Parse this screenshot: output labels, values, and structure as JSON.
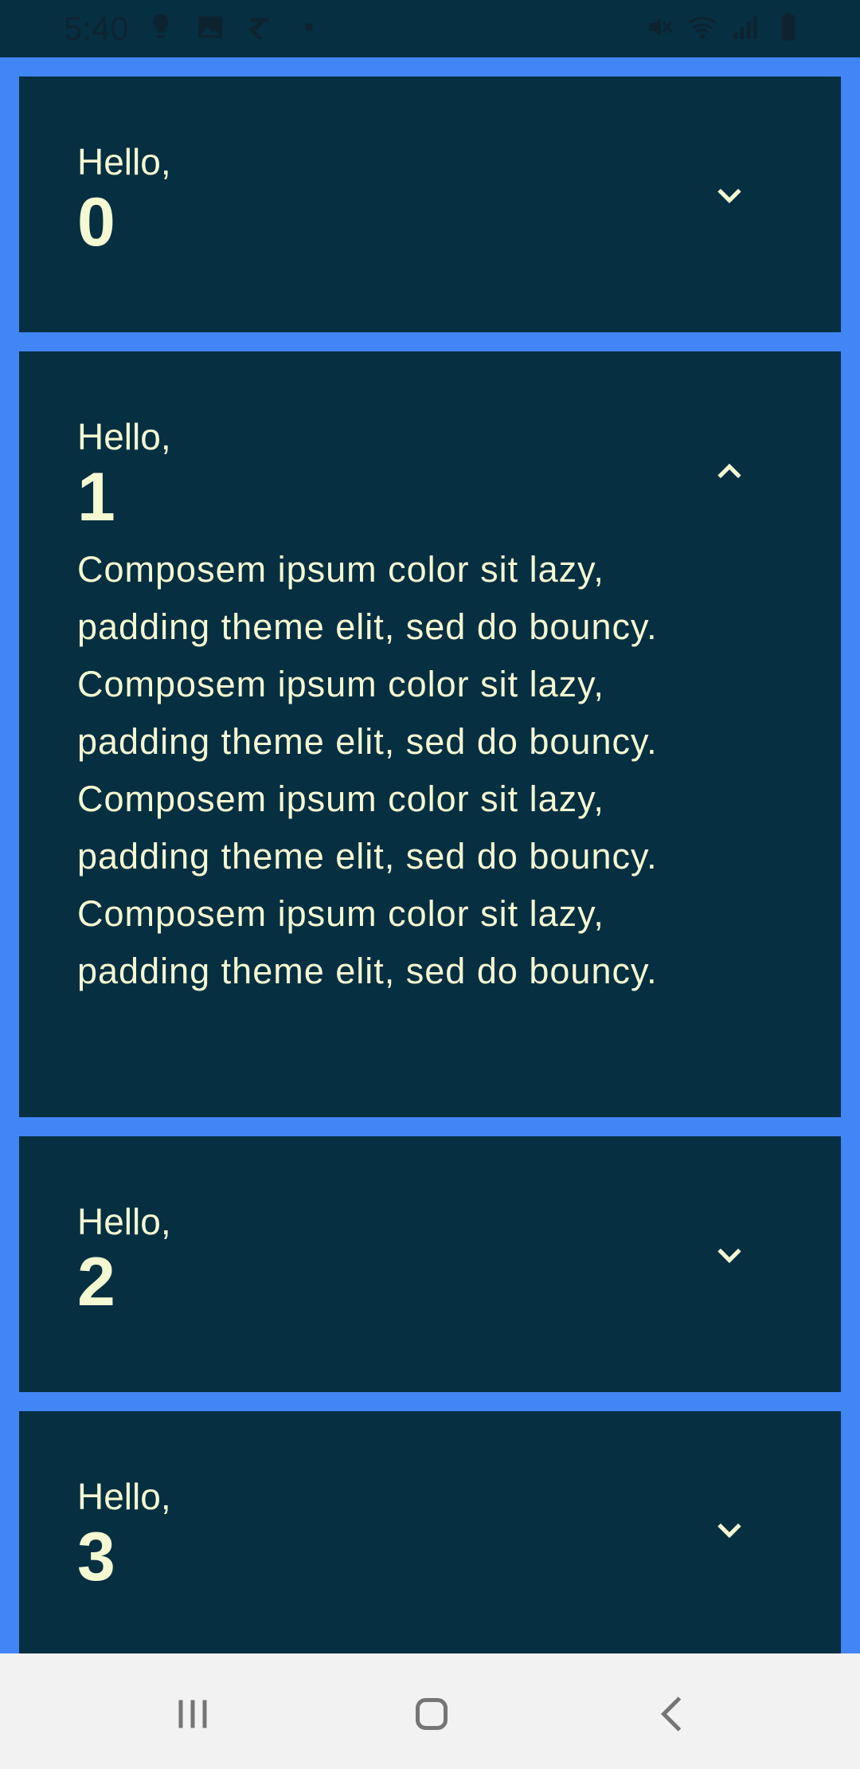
{
  "status_bar": {
    "time": "5:40",
    "left_icons": [
      "bulb-icon",
      "image-icon",
      "rupee-app-icon",
      "dot-icon"
    ],
    "right_icons": [
      "mute-icon",
      "wifi-icon",
      "signal-icon",
      "battery-icon"
    ]
  },
  "cards": [
    {
      "greeting": "Hello,",
      "number": "0",
      "expanded": false,
      "toggle_icon": "chevron-down-icon"
    },
    {
      "greeting": "Hello,",
      "number": "1",
      "expanded": true,
      "toggle_icon": "chevron-up-icon",
      "body": "Composem ipsum color sit lazy, padding theme elit, sed do bouncy. Composem ipsum color sit lazy, padding theme elit, sed do bouncy. Composem ipsum color sit lazy, padding theme elit, sed do bouncy. Composem ipsum color sit lazy, padding theme elit, sed do bouncy."
    },
    {
      "greeting": "Hello,",
      "number": "2",
      "expanded": false,
      "toggle_icon": "chevron-down-icon"
    },
    {
      "greeting": "Hello,",
      "number": "3",
      "expanded": false,
      "toggle_icon": "chevron-down-icon"
    }
  ],
  "nav_bar": {
    "buttons": [
      "recents-icon",
      "home-icon",
      "back-icon"
    ]
  },
  "colors": {
    "background": "#4285f4",
    "card": "#062f42",
    "text": "#f5f9d1",
    "status_bar": "#062f42",
    "nav_bar": "#f2f2f2"
  }
}
